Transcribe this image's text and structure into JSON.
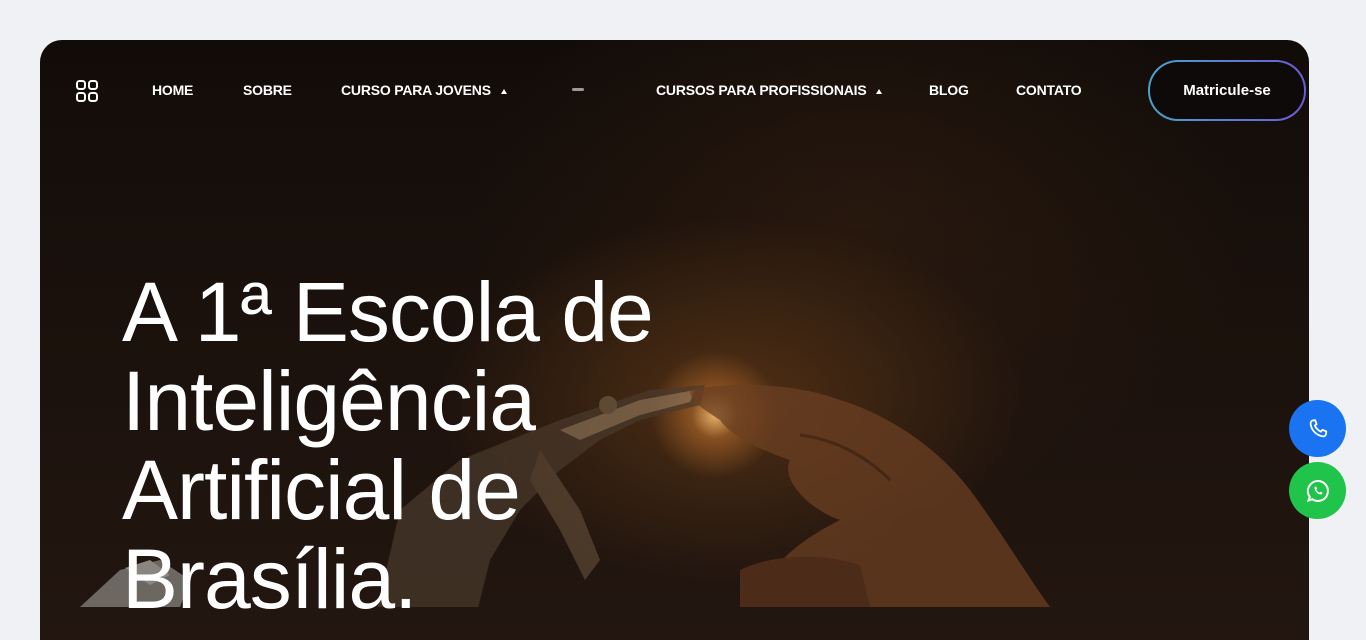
{
  "nav": {
    "items": [
      {
        "label": "HOME",
        "has_dropdown": false
      },
      {
        "label": "SOBRE",
        "has_dropdown": false
      },
      {
        "label": "CURSO PARA JOVENS",
        "has_dropdown": true
      },
      {
        "label": "CURSOS PARA PROFISSIONAIS",
        "has_dropdown": true
      },
      {
        "label": "BLOG",
        "has_dropdown": false
      },
      {
        "label": "CONTATO",
        "has_dropdown": false
      }
    ],
    "menu_icon": "grid-icon",
    "cta_label": "Matricule-se"
  },
  "hero": {
    "headline_lines": [
      "A 1ª Escola de",
      "Inteligência",
      "Artificial de",
      "Brasília."
    ],
    "background": "robot-hand-and-human-hand-touching"
  },
  "floating": {
    "phone_icon": "phone-icon",
    "whatsapp_icon": "whatsapp-icon",
    "phone_color": "#1a73f0",
    "whatsapp_color": "#21c44b"
  },
  "colors": {
    "page_bg": "#f0f1f4",
    "hero_bg": "#120c09",
    "cta_border_from": "#4aa3c9",
    "cta_border_to": "#6b5bd6"
  }
}
